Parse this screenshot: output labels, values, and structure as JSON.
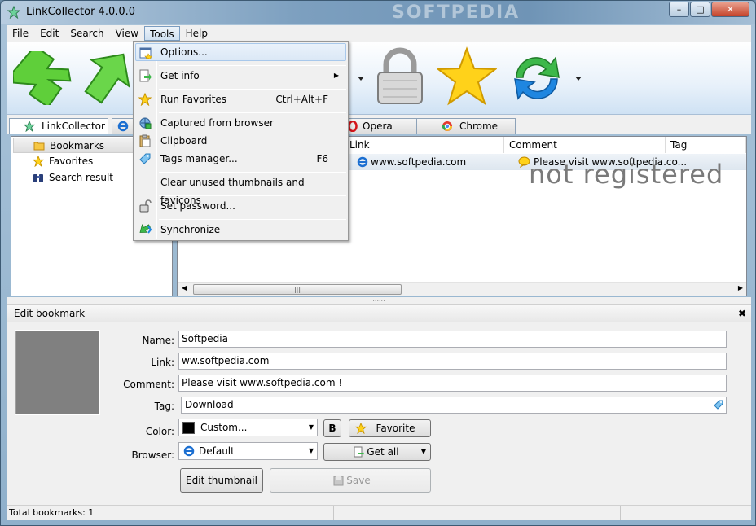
{
  "window": {
    "title": "LinkCollector 4.0.0.0",
    "watermark": "SOFTPEDIA",
    "min": "–",
    "max": "□",
    "close": "✕"
  },
  "menubar": {
    "items": [
      "File",
      "Edit",
      "Search",
      "View",
      "Tools",
      "Help"
    ],
    "active": "Tools"
  },
  "tools_menu": {
    "items": [
      {
        "label": "Options...",
        "shortcut": "",
        "submenu": false,
        "icon": "options-icon"
      },
      {
        "label": "Get info",
        "shortcut": "",
        "submenu": true,
        "icon": "get-info-icon"
      },
      {
        "label": "Run Favorites",
        "shortcut": "Ctrl+Alt+F",
        "submenu": false,
        "icon": "star-icon"
      },
      {
        "label": "Captured from browser",
        "shortcut": "",
        "submenu": false,
        "icon": "capture-icon"
      },
      {
        "label": "Clipboard",
        "shortcut": "",
        "submenu": false,
        "icon": "clipboard-icon"
      },
      {
        "label": "Tags manager...",
        "shortcut": "F6",
        "submenu": false,
        "icon": "tag-icon"
      },
      {
        "label": "Clear unused thumbnails and favicons",
        "shortcut": "",
        "submenu": false,
        "icon": ""
      },
      {
        "label": "Set password...",
        "shortcut": "",
        "submenu": false,
        "icon": "lock-icon"
      },
      {
        "label": "Synchronize",
        "shortcut": "",
        "submenu": false,
        "icon": "sync-icon"
      }
    ],
    "submenu_arrow": "▶"
  },
  "browser_tabs": {
    "linkcollector": "LinkCollector",
    "opera": "Opera",
    "chrome": "Chrome"
  },
  "tree": {
    "items": [
      "Bookmarks",
      "Favorites",
      "Search result"
    ]
  },
  "list": {
    "columns": [
      "Link",
      "Comment",
      "Tag"
    ],
    "rows": [
      {
        "link": "www.softpedia.com",
        "comment": "Please visit www.softpedia.co..."
      }
    ],
    "overlay": "not registered",
    "scroll_left": "◀",
    "scroll_right": "▶",
    "grip": "|||"
  },
  "splitter_grip": "......",
  "edit": {
    "header": "Edit bookmark",
    "close": "✖",
    "labels": {
      "name": "Name:",
      "link": "Link:",
      "comment": "Comment:",
      "tag": "Tag:",
      "color": "Color:",
      "browser": "Browser:"
    },
    "values": {
      "name": "Softpedia",
      "link": "ww.softpedia.com",
      "comment": "Please visit www.softpedia.com !",
      "tag": "Download",
      "color": "Custom...",
      "browser": "Default"
    },
    "buttons": {
      "bold": "B",
      "favorite": "Favorite",
      "get_all": "Get all",
      "edit_thumbnail": "Edit thumbnail",
      "save": "Save"
    },
    "combo_arrow": "▼"
  },
  "status": {
    "total": "Total bookmarks: 1"
  }
}
